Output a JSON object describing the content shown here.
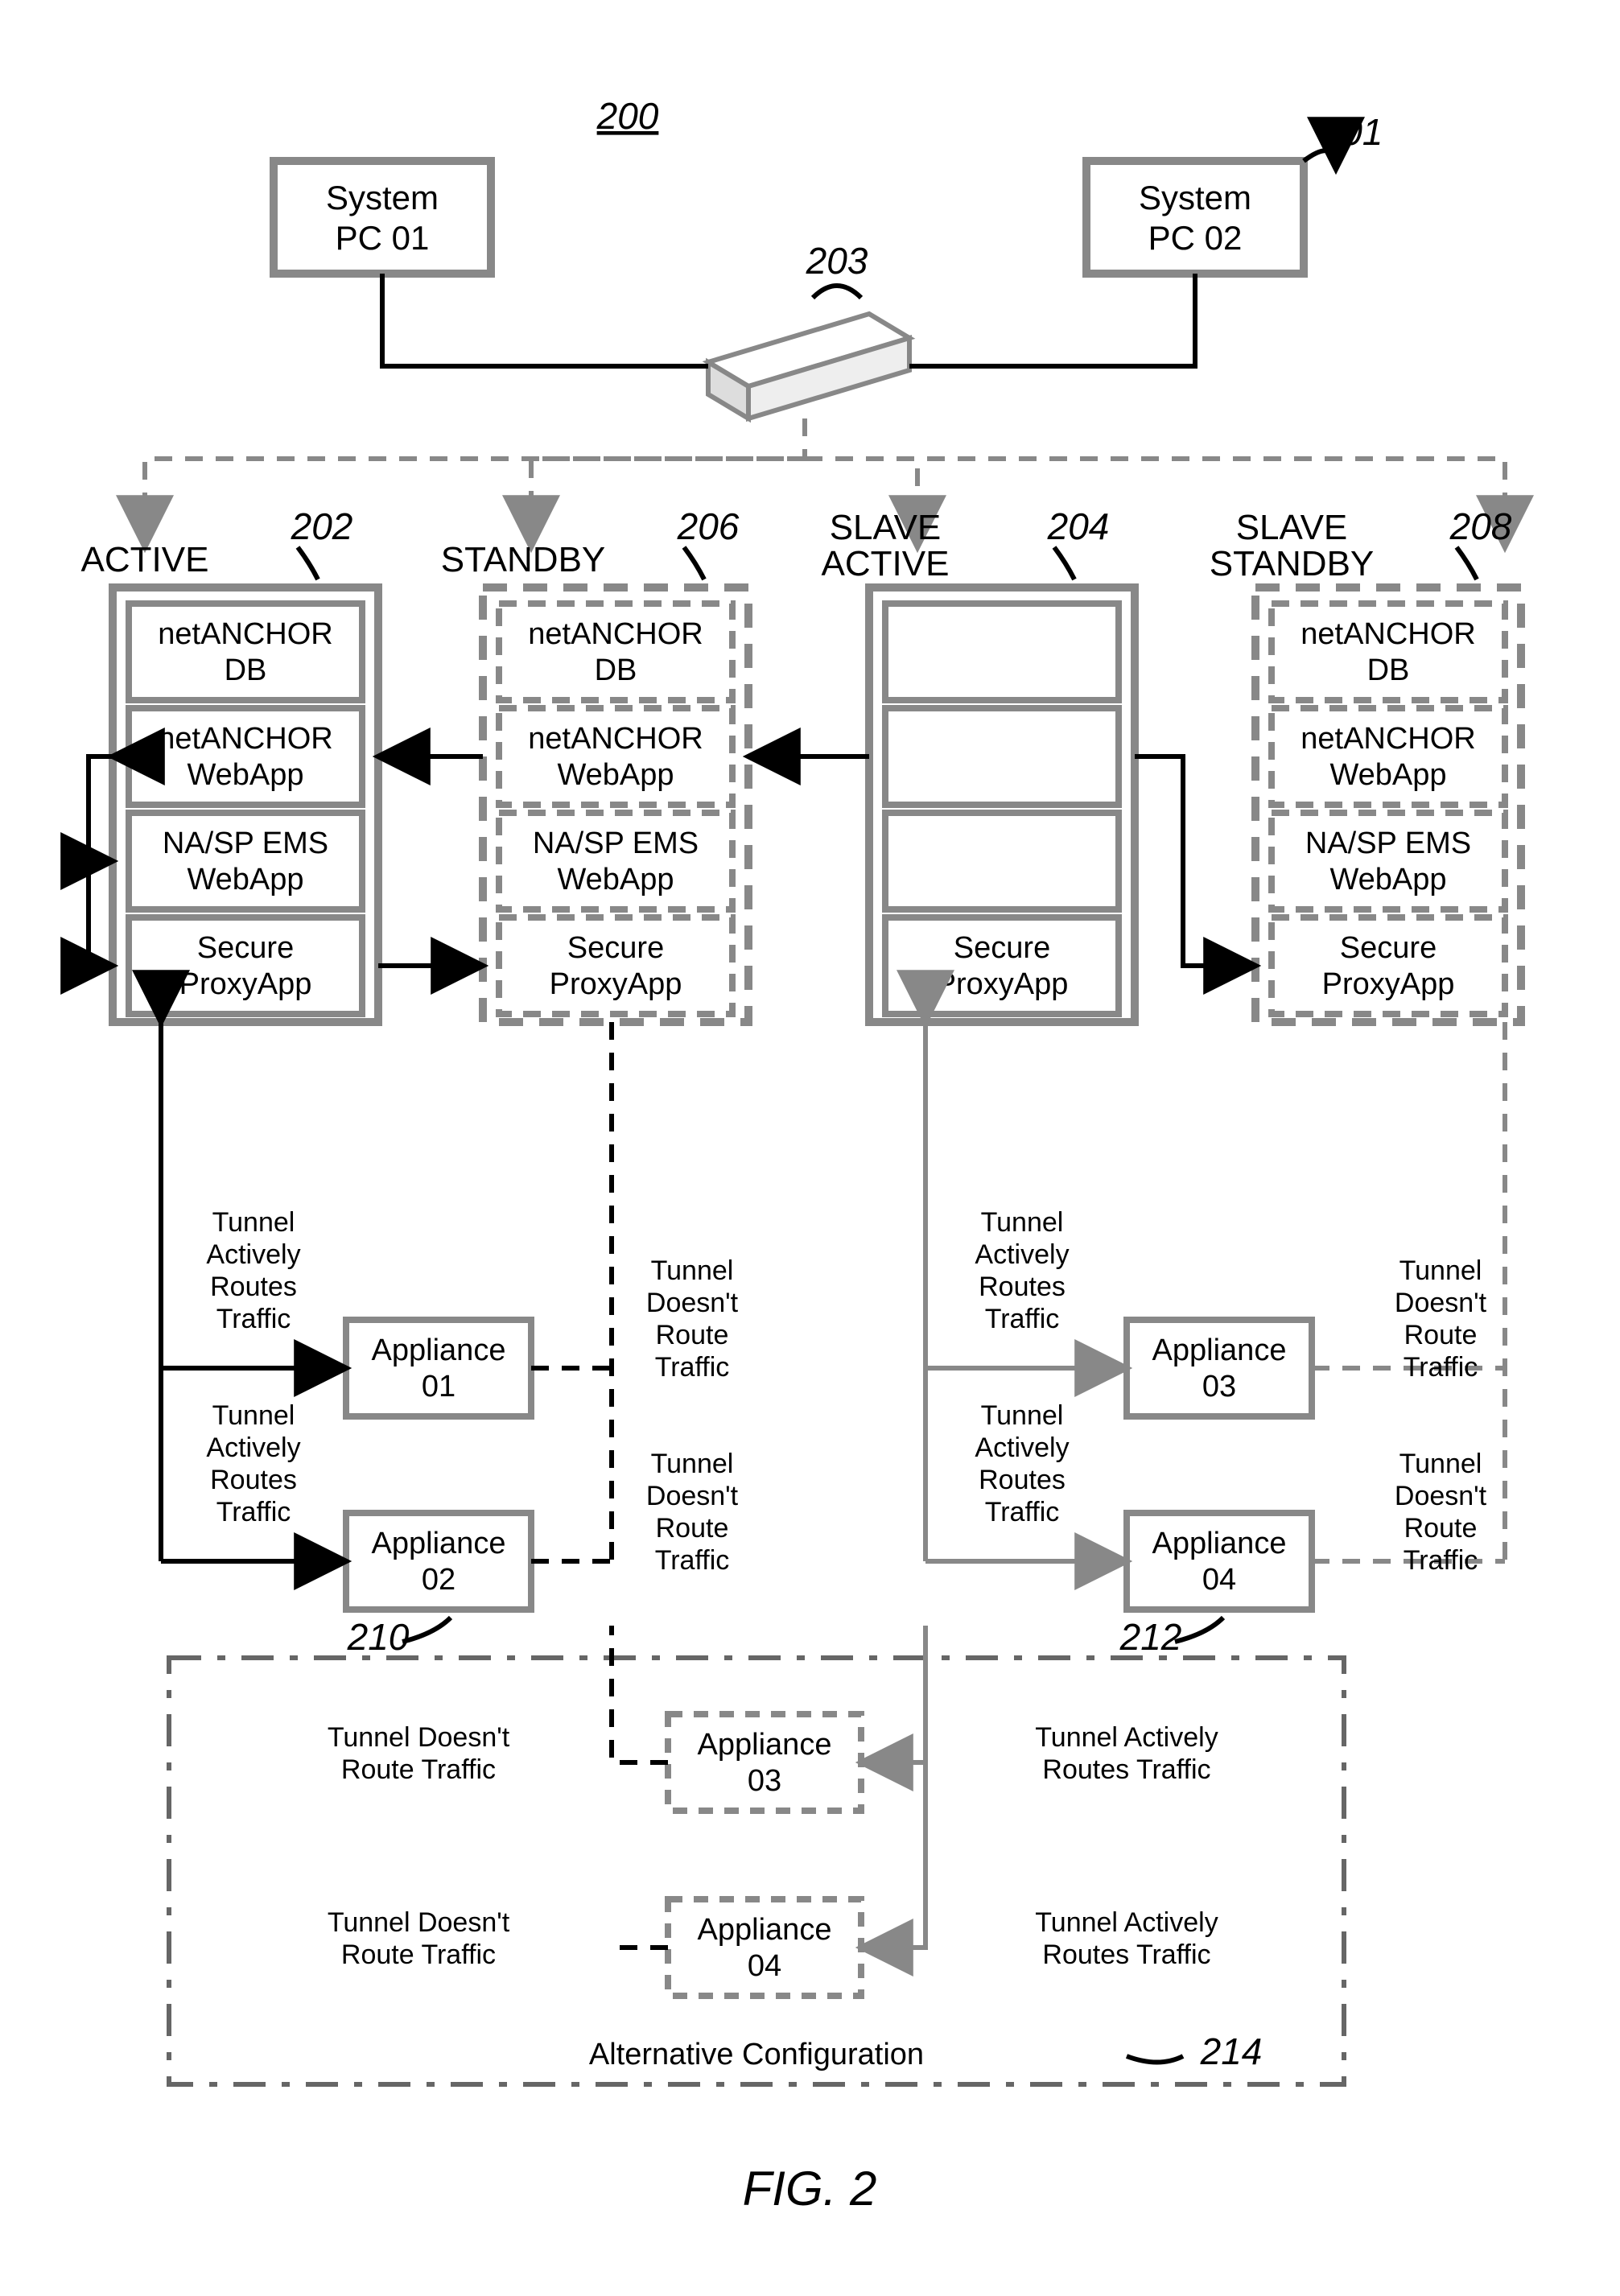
{
  "fig_ref": "200",
  "fig_label": "FIG. 2",
  "pc01": {
    "l1": "System",
    "l2": "PC 01"
  },
  "pc02": {
    "l1": "System",
    "l2": "PC 02",
    "ref": "201"
  },
  "hub_ref": "203",
  "roles": {
    "active": "ACTIVE",
    "standby": "STANDBY",
    "slave_active": "SLAVE\nACTIVE",
    "slave_standby": "SLAVE\nSTANDBY"
  },
  "refs": {
    "active": "202",
    "standby": "206",
    "slave_active": "204",
    "slave_standby": "208",
    "grp_left": "210",
    "grp_right": "212",
    "alt": "214"
  },
  "stack": {
    "db": "netANCHOR\nDB",
    "web": "netANCHOR\nWebApp",
    "ems": "NA/SP EMS\nWebApp",
    "proxy": "Secure\nProxyApp"
  },
  "app": {
    "a1": "Appliance\n01",
    "a2": "Appliance\n02",
    "a3": "Appliance\n03",
    "a4": "Appliance\n04"
  },
  "tunnel_active": "Tunnel\nActively\nRoutes\nTraffic",
  "tunnel_no": "Tunnel\nDoesn't\nRoute\nTraffic",
  "tunnel_active_h": "Tunnel Actively\nRoutes Traffic",
  "tunnel_no_h": "Tunnel Doesn't\nRoute Traffic",
  "alt_config": "Alternative Configuration"
}
